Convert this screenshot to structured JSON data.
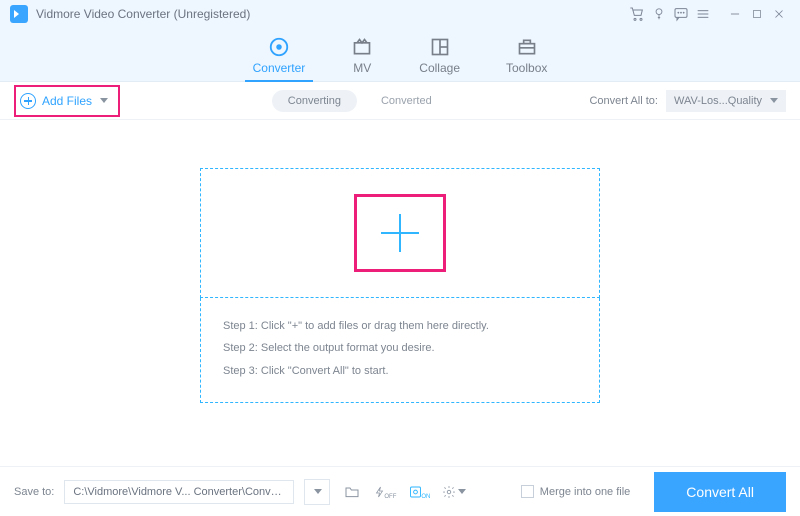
{
  "app": {
    "title": "Vidmore Video Converter (Unregistered)"
  },
  "tabs": {
    "converter": "Converter",
    "mv": "MV",
    "collage": "Collage",
    "toolbox": "Toolbox"
  },
  "subbar": {
    "add_files": "Add Files",
    "converting": "Converting",
    "converted": "Converted",
    "convert_all_to": "Convert All to:",
    "format_selected": "WAV-Los...Quality"
  },
  "dropzone": {
    "step1": "Step 1: Click \"+\" to add files or drag them here directly.",
    "step2": "Step 2: Select the output format you desire.",
    "step3": "Step 3: Click \"Convert All\" to start."
  },
  "footer": {
    "save_to_label": "Save to:",
    "path": "C:\\Vidmore\\Vidmore V... Converter\\Converted",
    "merge_label": "Merge into one file",
    "convert_all": "Convert All"
  }
}
